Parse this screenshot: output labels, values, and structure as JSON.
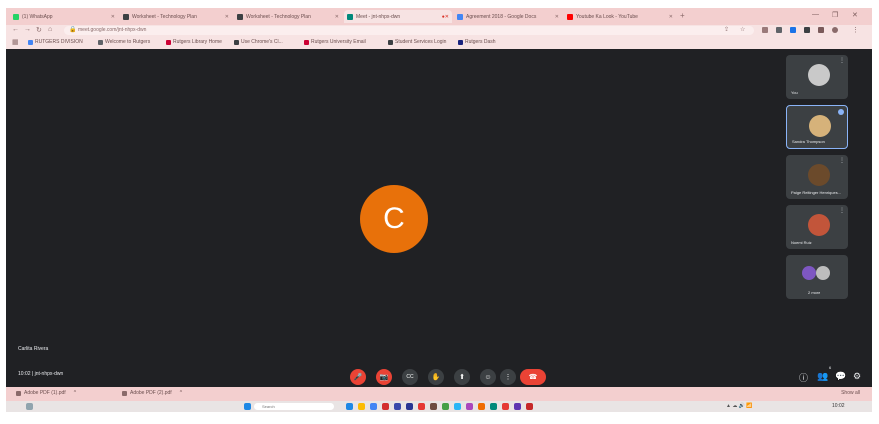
{
  "browser": {
    "tabs": [
      {
        "label": "(1) WhatsApp",
        "active": false,
        "favicon_color": "#25d366"
      },
      {
        "label": "Worksheet - Technology Plan",
        "active": false,
        "favicon_color": "#3c4043"
      },
      {
        "label": "Worksheet - Technology Plan",
        "active": false,
        "favicon_color": "#3c4043"
      },
      {
        "label": "Meet - jnt-nhpx-dwn",
        "active": true,
        "favicon_color": "#00897b"
      },
      {
        "label": "Agreement 2018 - Google Docs",
        "active": false,
        "favicon_color": "#4285f4"
      },
      {
        "label": "Youtube Ka Look - YouTube",
        "active": false,
        "favicon_color": "#ff0000"
      }
    ],
    "new_tab_glyph": "+",
    "url": "meet.google.com/jnt-nhpx-dwn",
    "bookmarks": [
      {
        "label": "RUTGERS DIVISION",
        "favicon_color": "#4285f4"
      },
      {
        "label": "Welcome to Rutgers",
        "favicon_color": "#5f6368"
      },
      {
        "label": "Rutgers Library Home",
        "favicon_color": "#cc0033"
      },
      {
        "label": "Use Chrome's Cl...",
        "favicon_color": "#3c4043"
      },
      {
        "label": "Rutgers University Email",
        "favicon_color": "#cc0033"
      },
      {
        "label": "Student Services Login",
        "favicon_color": "#3c4043"
      },
      {
        "label": "Rutgers Dash",
        "favicon_color": "#1a237e"
      }
    ]
  },
  "meet": {
    "main_avatar_letter": "C",
    "avatar_color": "#e8710a",
    "active_speaker": "Carlita Rivera",
    "meeting_time": "10:02",
    "meeting_code": "jnt-nhpx-dwn",
    "participants": [
      {
        "name": "You",
        "active": false,
        "photo_color": "#c9c9c9"
      },
      {
        "name": "Sandra Thompson",
        "active": true,
        "photo_color": "#d6b27a"
      },
      {
        "name": "Paige Reitinger Henriques...",
        "active": false,
        "photo_color": "#6b4a2b"
      },
      {
        "name": "Noemi Ruiz",
        "active": false,
        "photo_color": "#c2553a"
      },
      {
        "name": "2 more",
        "active": false,
        "photo_color": "#7e57c2"
      }
    ],
    "tile_more_glyph": "⋮",
    "controls": [
      {
        "name": "mic-button",
        "glyph": "🎤",
        "red": true
      },
      {
        "name": "camera-button",
        "glyph": "📷",
        "red": true
      },
      {
        "name": "captions-button",
        "glyph": "CC",
        "red": false
      },
      {
        "name": "raise-hand-button",
        "glyph": "✋",
        "red": false
      },
      {
        "name": "present-button",
        "glyph": "⬆",
        "red": false
      },
      {
        "name": "emoji-button",
        "glyph": "☺",
        "red": false
      },
      {
        "name": "more-options-button",
        "glyph": "⋮",
        "red": false
      }
    ],
    "end_call_glyph": "☎",
    "right_controls": [
      {
        "name": "info-button",
        "glyph": "ⓘ"
      },
      {
        "name": "people-button",
        "glyph": "👥",
        "badge": "6"
      },
      {
        "name": "chat-button",
        "glyph": "💬"
      },
      {
        "name": "activities-button",
        "glyph": "⚙"
      }
    ]
  },
  "downloads": {
    "items": [
      {
        "label": "Adobe PDF (1).pdf"
      },
      {
        "label": "Adobe PDF (2).pdf"
      }
    ],
    "show_all": "Show all"
  },
  "taskbar": {
    "search_placeholder": "Search",
    "time": "10:02",
    "app_colors": [
      "#1e88e5",
      "#fbbc04",
      "#4285f4",
      "#d32f2f",
      "#3949ab",
      "#283593",
      "#e53935",
      "#6d4c41",
      "#43a047",
      "#29b6f6",
      "#ab47bc",
      "#ef6c00",
      "#00897b",
      "#e53935",
      "#5e35b1",
      "#c62828"
    ]
  }
}
